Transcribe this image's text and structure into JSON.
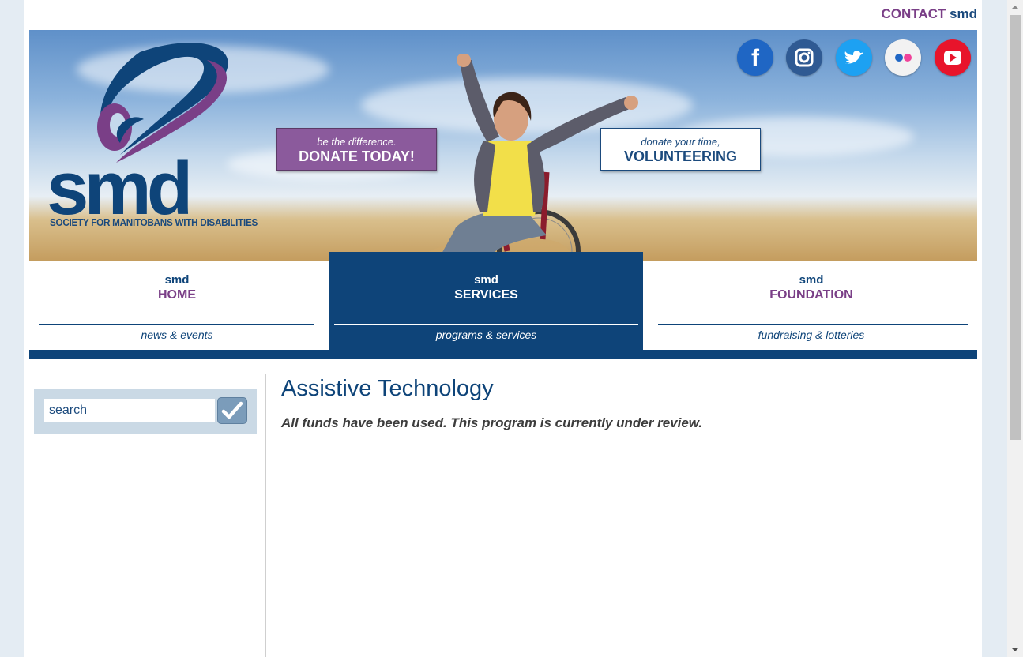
{
  "header": {
    "contact_word": "CONTACT",
    "contact_brand": "smd"
  },
  "banner": {
    "logo_text": "smd",
    "logo_tagline": "SOCIETY FOR MANITOBANS WITH DISABILITIES",
    "donate": {
      "small": "be the difference.",
      "big": "DONATE TODAY!"
    },
    "volunteer": {
      "small": "donate your time,",
      "big": "VOLUNTEERING"
    },
    "social": [
      {
        "name": "facebook-icon",
        "color": "#1f66c4",
        "glyph": "f"
      },
      {
        "name": "instagram-icon",
        "color": "#2f5a93",
        "glyph": "◎"
      },
      {
        "name": "twitter-icon",
        "color": "#1da1f2",
        "glyph": "🐦"
      },
      {
        "name": "flickr-icon",
        "color": "#f2f2f2",
        "glyph": "••"
      },
      {
        "name": "youtube-icon",
        "color": "#e8142b",
        "glyph": "▶"
      }
    ]
  },
  "nav": {
    "items": [
      {
        "line1": "smd",
        "line2": "HOME",
        "sub": "news & events"
      },
      {
        "line1": "smd",
        "line2": "SERVICES",
        "sub": "programs & services"
      },
      {
        "line1": "smd",
        "line2": "FOUNDATION",
        "sub": "fundraising & lotteries"
      }
    ],
    "active_index": 1
  },
  "sidebar": {
    "search_label": "search",
    "search_value": ""
  },
  "main": {
    "title": "Assistive Technology",
    "note": "All funds have been used. This program is currently under review."
  },
  "colors": {
    "brand_blue": "#0e4479",
    "brand_purple": "#7a3f87"
  }
}
